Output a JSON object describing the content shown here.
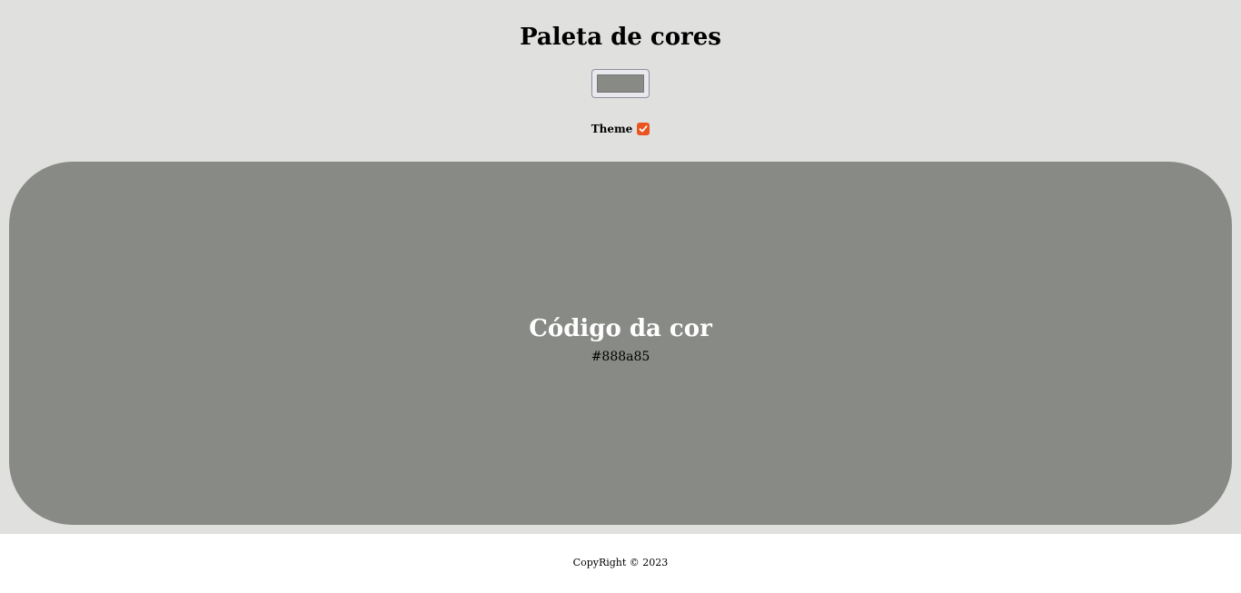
{
  "header": {
    "title": "Paleta de cores"
  },
  "picker": {
    "value": "#888a85"
  },
  "theme": {
    "label": "Theme",
    "checked": true,
    "accent": "#e95420"
  },
  "preview": {
    "heading": "Código da cor",
    "code": "#888a85",
    "color": "#888a85"
  },
  "footer": {
    "copyright": "CopyRight © 2023"
  },
  "colors": {
    "page_background": "#e0e0df",
    "footer_background": "#ffffff"
  }
}
